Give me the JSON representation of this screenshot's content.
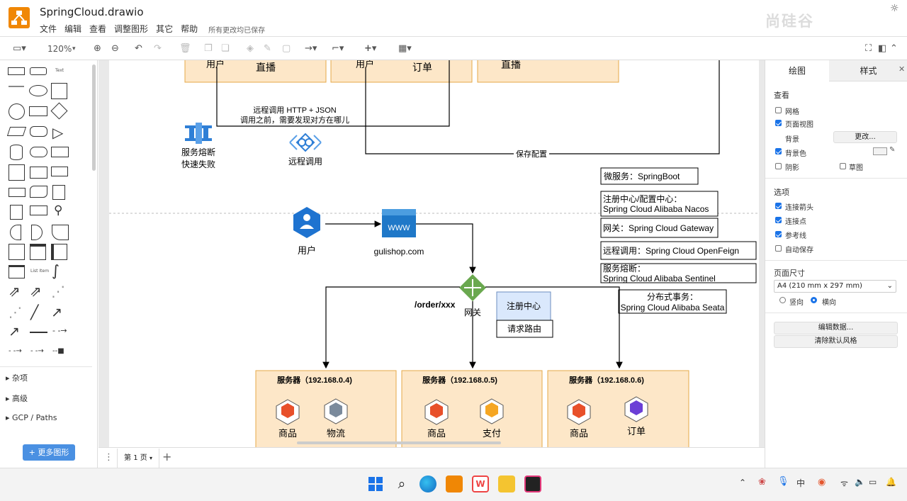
{
  "app": {
    "title": "SpringCloud.drawio",
    "menu": [
      "文件",
      "编辑",
      "查看",
      "调整图形",
      "其它",
      "帮助"
    ],
    "save_status": "所有更改均已保存",
    "watermark": "尚硅谷"
  },
  "toolbar": {
    "zoom": "120%"
  },
  "left_panel": {
    "sections": [
      "杂项",
      "高级",
      "GCP / Paths"
    ],
    "more_shapes": "+ 更多图形"
  },
  "bottom": {
    "page_tab": "第 1 页"
  },
  "right_panel": {
    "tabs": [
      "绘图",
      "样式"
    ],
    "view_heading": "查看",
    "view_items": [
      {
        "label": "网格",
        "checked": false
      },
      {
        "label": "页面视图",
        "checked": true
      }
    ],
    "background_label": "背景",
    "change_btn": "更改...",
    "bgcolor_label": "背景色",
    "bgcolor_checked": true,
    "shadow_label": "阴影",
    "sketch_label": "草图",
    "options_heading": "选项",
    "options": [
      {
        "label": "连接箭头",
        "checked": true
      },
      {
        "label": "连接点",
        "checked": true
      },
      {
        "label": "参考线",
        "checked": true
      },
      {
        "label": "自动保存",
        "checked": false
      }
    ],
    "page_size_heading": "页面尺寸",
    "page_size": "A4 (210 mm x 297 mm)",
    "portrait": "竖向",
    "landscape": "横向",
    "edit_data": "编辑数据...",
    "clear_style": "清除默认风格"
  },
  "diagram": {
    "top_boxes": [
      {
        "a": "用户",
        "b": "直播"
      },
      {
        "a": "用户",
        "b": "订单"
      },
      {
        "a": "",
        "b": "直播"
      }
    ],
    "remote_call_note": [
      "远程调用 HTTP + JSON",
      "调用之前，需要发现对方在哪儿"
    ],
    "circuit_breaker": [
      "服务熔断",
      "快速失败"
    ],
    "remote_call": "远程调用",
    "save_config": "保存配置",
    "legend": [
      "微服务：SpringBoot",
      "注册中心/配置中心：",
      "Spring Cloud Alibaba Nacos",
      "网关：Spring Cloud Gateway",
      "远程调用：Spring Cloud OpenFeign",
      "服务熔断：",
      "Spring Cloud Alibaba Sentinel",
      "分布式事务：",
      "Spring Cloud Alibaba Seata"
    ],
    "user_label": "用户",
    "www": "WWW",
    "site": "gulishop.com",
    "route_path": "/order/xxx",
    "gateway": "网关",
    "registry": "注册中心",
    "request_routing": "请求路由",
    "servers": [
      {
        "title": "服务器（192.168.0.4)",
        "items": [
          "商品",
          "物流"
        ]
      },
      {
        "title": "服务器（192.168.0.5)",
        "items": [
          "商品",
          "支付"
        ]
      },
      {
        "title": "服务器（192.168.0.6)",
        "items": [
          "商品",
          "订单"
        ]
      }
    ]
  }
}
